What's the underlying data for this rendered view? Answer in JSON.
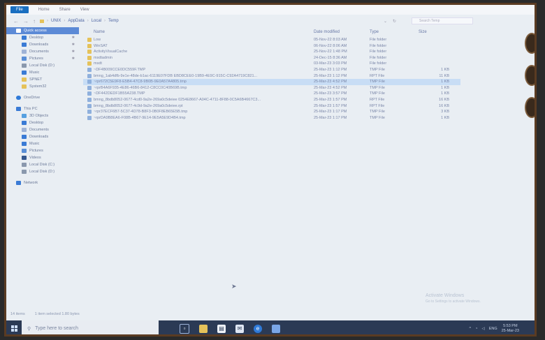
{
  "ribbon": {
    "tabs": [
      "File",
      "Home",
      "Share",
      "View"
    ]
  },
  "address": {
    "crumbs": [
      "UNIX",
      "AppData",
      "Local",
      "Temp"
    ],
    "search_placeholder": "Search Temp"
  },
  "nav": {
    "quick_access": "Quick access",
    "pinned": [
      "Desktop",
      "Downloads",
      "Documents",
      "Pictures"
    ],
    "others": [
      "Local Disk (D:)",
      "Music",
      "SPNET",
      "System32"
    ],
    "onedrive": "OneDrive",
    "thispc": "This PC",
    "pc_items": [
      "3D Objects",
      "Desktop",
      "Documents",
      "Downloads",
      "Music",
      "Pictures",
      "Videos",
      "Local Disk (C:)",
      "Local Disk (D:)"
    ],
    "network": "Network"
  },
  "columns": {
    "name": "Name",
    "date": "Date modified",
    "type": "Type",
    "size": "Size"
  },
  "files": [
    {
      "name": "Low",
      "date": "05-Nov-22 8:03 AM",
      "type": "File folder",
      "size": "",
      "icon": "folder"
    },
    {
      "name": "WinSAT",
      "date": "06-Nov-22 8:06 AM",
      "type": "File folder",
      "size": "",
      "icon": "folder"
    },
    {
      "name": "ActivityVisualCache",
      "date": "25-Nov-22 1:48 PM",
      "type": "File folder",
      "size": "",
      "icon": "folder"
    },
    {
      "name": "msdtadmin",
      "date": "24-Dec-15 8:36 AM",
      "type": "File folder",
      "size": "",
      "icon": "folder"
    },
    {
      "name": "msdt",
      "date": "03-Mar-23 3:03 PM",
      "type": "File folder",
      "size": "",
      "icon": "folder"
    },
    {
      "name": "~DF4B009CCE0DC559F.TMP",
      "date": "25-Mar-23 1:12 PM",
      "type": "TMP File",
      "size": "1 KB",
      "icon": "file"
    },
    {
      "name": "bmng_1ab4dfb-9e1e-48de-b1ac-6119E07FDB EBD8CEE0-19B9-4E9C-915C-C92A4719C821...",
      "date": "25-Mar-23 1:12 PM",
      "type": "RPT File",
      "size": "11 KB",
      "icon": "file"
    },
    {
      "name": "~rpr672C5E9F8-E5B4-47C8-9B0B-9E0A57A4805.tmp",
      "date": "25-Mar-23 4:52 PM",
      "type": "TMP File",
      "size": "1 KB",
      "icon": "file",
      "selected": true
    },
    {
      "name": "~rprB4A6F935-4E86-46B6-8412-C8CC0C40B69B.tmp",
      "date": "25-Mar-23 4:52 PM",
      "type": "TMP File",
      "size": "1 KB",
      "icon": "file"
    },
    {
      "name": "~DF442DEDF1B55A238.TMP",
      "date": "25-Mar-23 3:57 PM",
      "type": "TMP File",
      "size": "1 KB",
      "icon": "file"
    },
    {
      "name": "bmng_8bdb8052-0677-4cd0-9a2e-269a0c5deiee 0254E8667-A04C-4711-8F88-0C5A6B4667C3...",
      "date": "25-Mar-23 1:57 PM",
      "type": "RPT File",
      "size": "16 KB",
      "icon": "file"
    },
    {
      "name": "bmng_8bdb8052-0677-4c9d-9a2e-269a0c5deiee.rpt",
      "date": "25-Mar-23 1:57 PM",
      "type": "RPT File",
      "size": "16 KB",
      "icon": "file"
    },
    {
      "name": "~rpr37ECF6B7-5C37-4D78-B8F3-0B0F8EB65E5B.tmp",
      "date": "25-Mar-23 1:17 PM",
      "type": "TMP File",
      "size": "3 KB",
      "icon": "file"
    },
    {
      "name": "~rprDA9B8EA6-F08B-4B67-9E14-9E5A5E9D4B4.tmp",
      "date": "25-Mar-23 1:17 PM",
      "type": "TMP File",
      "size": "1 KB",
      "icon": "file"
    }
  ],
  "status": {
    "count": "14 items",
    "selected": "1 item selected 1.80 bytes"
  },
  "watermark": {
    "title": "Activate Windows",
    "sub": "Go to Settings to activate Windows."
  },
  "taskbar": {
    "search_placeholder": "Type here to search",
    "time": "5:53 PM",
    "date": "25-Mar-23",
    "lang": "ENG"
  },
  "colors": {
    "folder": "#e5c25a",
    "file": "#8fb0dd",
    "accent": "#1a6fc0"
  }
}
